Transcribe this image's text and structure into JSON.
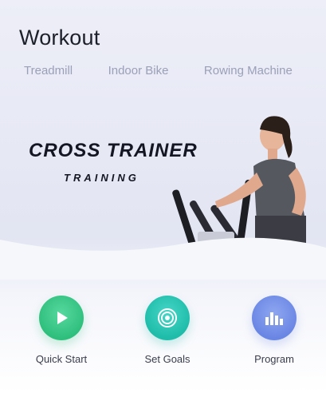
{
  "header": {
    "title": "Workout",
    "tabs": [
      "Treadmill",
      "Indoor Bike",
      "Rowing Machine"
    ]
  },
  "banner": {
    "title": "CROSS TRAINER",
    "subtitle": "TRAINING"
  },
  "actions": [
    {
      "label": "Quick Start",
      "icon": "play-icon",
      "color": "#2fbf7d"
    },
    {
      "label": "Set Goals",
      "icon": "target-icon",
      "color": "#1fbcaa"
    },
    {
      "label": "Program",
      "icon": "chart-icon",
      "color": "#6a86e4"
    }
  ]
}
